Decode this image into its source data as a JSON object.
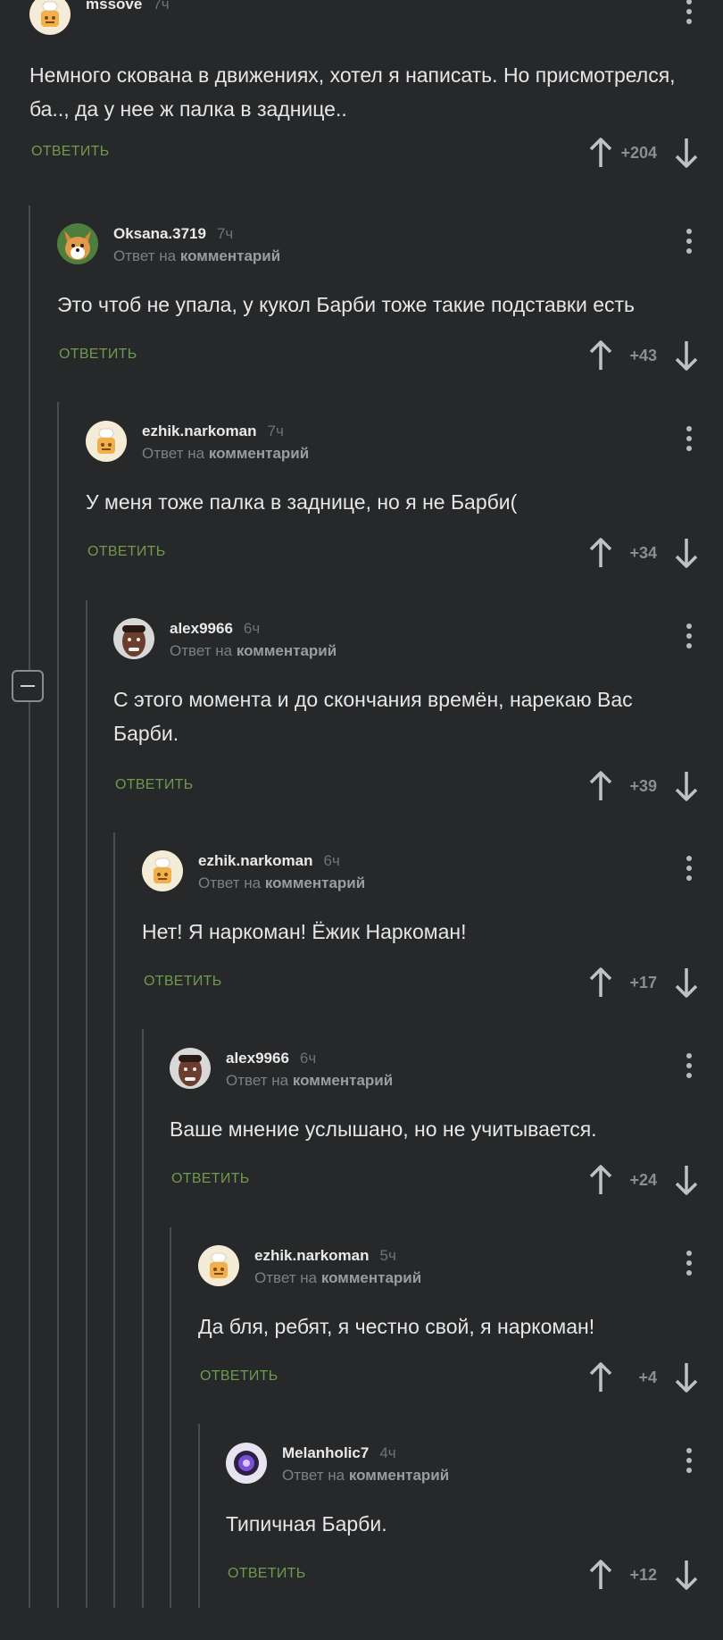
{
  "ui": {
    "reply_prefix": "Ответ на",
    "reply_target": "комментарий",
    "reply_label": "ОТВЕТИТЬ"
  },
  "colors": {
    "background": "#26282a",
    "reply_button": "#6f9a4e",
    "thread_line": "#4a4c4f",
    "muted_text": "#7d8083"
  },
  "comments": [
    {
      "user": "mssove",
      "time": "7ч",
      "is_reply": false,
      "avatar": "chef-avatar",
      "text": "Немного скована в движениях, хотел я написать. Но присмотрелся, ба.., да у нее ж палка в заднице..",
      "score": "+204"
    },
    {
      "user": "Oksana.3719",
      "time": "7ч",
      "is_reply": true,
      "avatar": "corgi-avatar",
      "text": "Это чтоб не упала, у кукол Барби тоже такие подставки есть",
      "score": "+43"
    },
    {
      "user": "ezhik.narkoman",
      "time": "7ч",
      "is_reply": true,
      "avatar": "chef-avatar",
      "text": "У меня тоже палка в заднице, но я не Барби(",
      "score": "+34"
    },
    {
      "user": "alex9966",
      "time": "6ч",
      "is_reply": true,
      "avatar": "face-avatar",
      "text": "С этого момента и до скончания времён, нарекаю Вас Барби.",
      "score": "+39"
    },
    {
      "user": "ezhik.narkoman",
      "time": "6ч",
      "is_reply": true,
      "avatar": "chef-avatar",
      "text": "Нет! Я наркоман! Ёжик Наркоман!",
      "score": "+17"
    },
    {
      "user": "alex9966",
      "time": "6ч",
      "is_reply": true,
      "avatar": "face-avatar",
      "text": "Ваше мнение услышано, но не учитывается.",
      "score": "+24"
    },
    {
      "user": "ezhik.narkoman",
      "time": "5ч",
      "is_reply": true,
      "avatar": "chef-avatar",
      "text": "Да бля, ребят, я честно свой, я наркоман!",
      "score": "+4"
    },
    {
      "user": "Melanholic7",
      "time": "4ч",
      "is_reply": true,
      "avatar": "purple-eye-avatar",
      "text": "Типичная Барби.",
      "score": "+12"
    }
  ]
}
